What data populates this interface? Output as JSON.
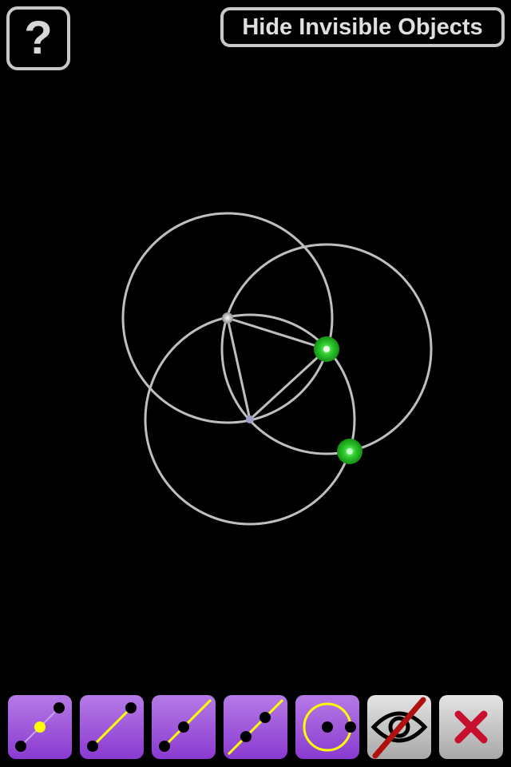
{
  "help_button": {
    "label": "?"
  },
  "visibility_toggle": {
    "label": "Hide Invisible Objects"
  },
  "toolbar": {
    "tools": [
      {
        "name": "point-on-segment-tool",
        "icon": "point-on-line-icon"
      },
      {
        "name": "segment-tool",
        "icon": "segment-icon"
      },
      {
        "name": "ray-tool",
        "icon": "ray-icon"
      },
      {
        "name": "line-tool",
        "icon": "line-icon"
      },
      {
        "name": "circle-tool",
        "icon": "circle-icon"
      },
      {
        "name": "hide-object-tool",
        "icon": "eye-slash-icon"
      },
      {
        "name": "delete-tool",
        "icon": "delete-x-icon"
      }
    ]
  },
  "colors": {
    "background": "#000000",
    "construction_stroke": "#bfbfbf",
    "highlight_point": "#2ecc2e",
    "tool_purple": "#9a4ee0",
    "tool_grey": "#c8c8c8",
    "accent_yellow": "#ffff00",
    "delete_red": "#c8102e"
  }
}
